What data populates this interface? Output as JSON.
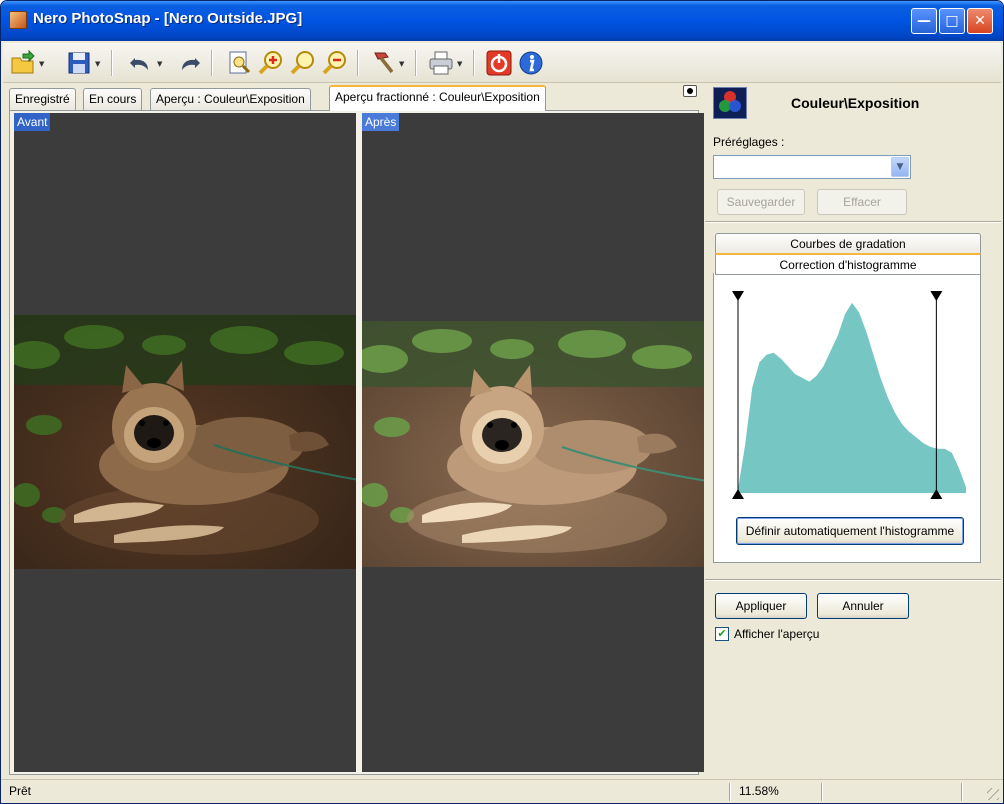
{
  "window": {
    "title": "Nero PhotoSnap - [Nero Outside.JPG]"
  },
  "toolbar": {
    "buttons": [
      {
        "name": "open-folder-icon",
        "has_dropdown": true
      },
      {
        "name": "save-icon",
        "has_dropdown": true
      },
      {
        "name": "undo-icon",
        "has_dropdown": true
      },
      {
        "name": "redo-icon",
        "has_dropdown": false
      },
      {
        "name": "fit-page-icon",
        "has_dropdown": false
      },
      {
        "name": "zoom-in-icon",
        "has_dropdown": false
      },
      {
        "name": "zoom-actual-icon",
        "has_dropdown": false
      },
      {
        "name": "zoom-out-icon",
        "has_dropdown": false
      },
      {
        "name": "tools-hammer-icon",
        "has_dropdown": true
      },
      {
        "name": "print-icon",
        "has_dropdown": true
      },
      {
        "name": "power-exit-icon",
        "has_dropdown": false
      },
      {
        "name": "info-icon",
        "has_dropdown": false
      }
    ]
  },
  "tabs": [
    {
      "label": "Enregistré",
      "active": false
    },
    {
      "label": "En cours",
      "active": false
    },
    {
      "label": "Aperçu : Couleur\\Exposition",
      "active": false
    },
    {
      "label": "Aperçu fractionné : Couleur\\Exposition",
      "active": true
    }
  ],
  "preview": {
    "before_label": "Avant",
    "after_label": "Après"
  },
  "panel": {
    "title": "Couleur\\Exposition",
    "presets_label": "Préréglages :",
    "presets_value": "",
    "save_button": "Sauvegarder",
    "delete_button": "Effacer",
    "subtab_curves": "Courbes de gradation",
    "subtab_histogram": "Correction d'histogramme",
    "auto_histogram_button": "Définir automatiquement l'histogramme",
    "apply_button": "Appliquer",
    "cancel_button": "Annuler",
    "show_preview_label": "Afficher l'aperçu",
    "show_preview_checked": true,
    "histogram": {
      "color": "#76c7c3",
      "left_marker": 0.0,
      "right_marker": 0.87,
      "values": [
        0.02,
        0.25,
        0.55,
        0.68,
        0.72,
        0.73,
        0.7,
        0.66,
        0.62,
        0.6,
        0.58,
        0.61,
        0.66,
        0.74,
        0.82,
        0.93,
        0.99,
        0.94,
        0.84,
        0.72,
        0.6,
        0.5,
        0.42,
        0.36,
        0.32,
        0.29,
        0.26,
        0.24,
        0.23,
        0.23,
        0.21,
        0.13,
        0.03
      ]
    }
  },
  "status": {
    "text": "Prêt",
    "zoom": "11.58%"
  }
}
